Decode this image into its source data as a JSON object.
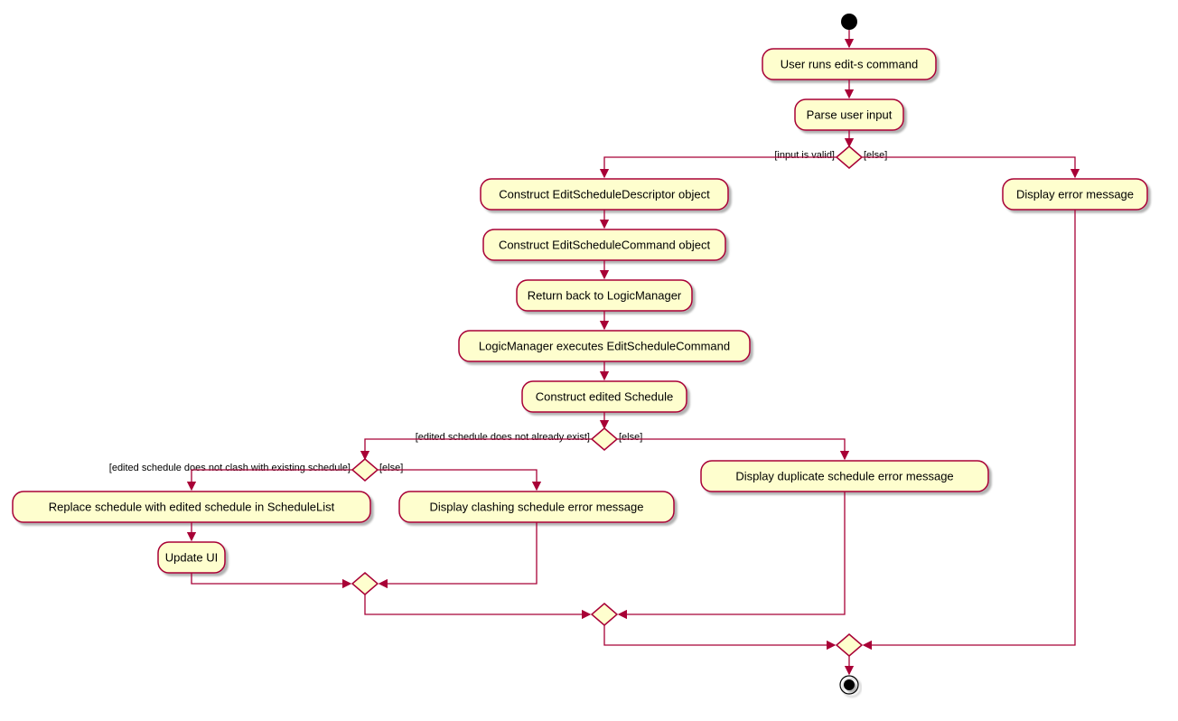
{
  "nodes": {
    "n1": "User runs edit-s command",
    "n2": "Parse user input",
    "n3": "Construct EditScheduleDescriptor object",
    "n4": "Construct EditScheduleCommand object",
    "n5": "Return back to LogicManager",
    "n6": "LogicManager executes EditScheduleCommand",
    "n7": "Construct edited Schedule",
    "n8": "Replace schedule with edited schedule in ScheduleList",
    "n9": "Update UI",
    "n10": "Display clashing schedule error message",
    "n11": "Display duplicate schedule error message",
    "n12": "Display error message"
  },
  "guards": {
    "g1_left": "[input is valid]",
    "g1_right": "[else]",
    "g2_left": "[edited schedule does not already exist]",
    "g2_right": "[else]",
    "g3_left": "[edited schedule does not clash with existing schedule]",
    "g3_right": "[else]"
  }
}
